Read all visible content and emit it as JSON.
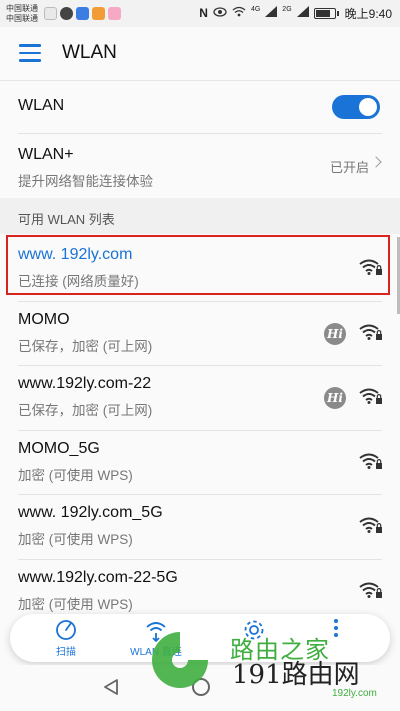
{
  "status_bar": {
    "carrier_1": "中国联通",
    "carrier_2": "中国联通",
    "network_tag": "4G",
    "signal_tag": "2G",
    "time": "晚上9:40",
    "battery_level": 0.8
  },
  "header": {
    "title": "WLAN"
  },
  "settings": {
    "wlan_label": "WLAN",
    "wlan_enabled": true,
    "wlan_plus_label": "WLAN+",
    "wlan_plus_desc": "提升网络智能连接体验",
    "wlan_plus_status": "已开启"
  },
  "section": {
    "label": "可用 WLAN 列表"
  },
  "networks": [
    {
      "ssid": "www. 192ly.com",
      "status": "已连接 (网络质量好)",
      "connected": true,
      "hi": false,
      "secured": true
    },
    {
      "ssid": "MOMO",
      "status": "已保存，加密 (可上网)",
      "connected": false,
      "hi": true,
      "secured": true
    },
    {
      "ssid": "www.192ly.com-22",
      "status": "已保存，加密 (可上网)",
      "connected": false,
      "hi": true,
      "secured": true
    },
    {
      "ssid": "MOMO_5G",
      "status": "加密 (可使用 WPS)",
      "connected": false,
      "hi": false,
      "secured": true
    },
    {
      "ssid": "www. 192ly.com_5G",
      "status": "加密 (可使用 WPS)",
      "connected": false,
      "hi": false,
      "secured": true
    },
    {
      "ssid": "www.192ly.com-22-5G",
      "status": "加密 (可使用 WPS)",
      "connected": false,
      "hi": false,
      "secured": true
    }
  ],
  "hi_badge": "Hi",
  "bottom_bar": {
    "scan_label": "扫描",
    "wlan_direct_label": "WLAN 直连"
  },
  "watermark": {
    "brand_cn": "路由之家",
    "brand_num": "191路由网",
    "url": "192ly.com"
  },
  "colors": {
    "accent": "#1a73d6",
    "highlight_border": "#d9231f",
    "watermark_green": "#3fae3f"
  }
}
